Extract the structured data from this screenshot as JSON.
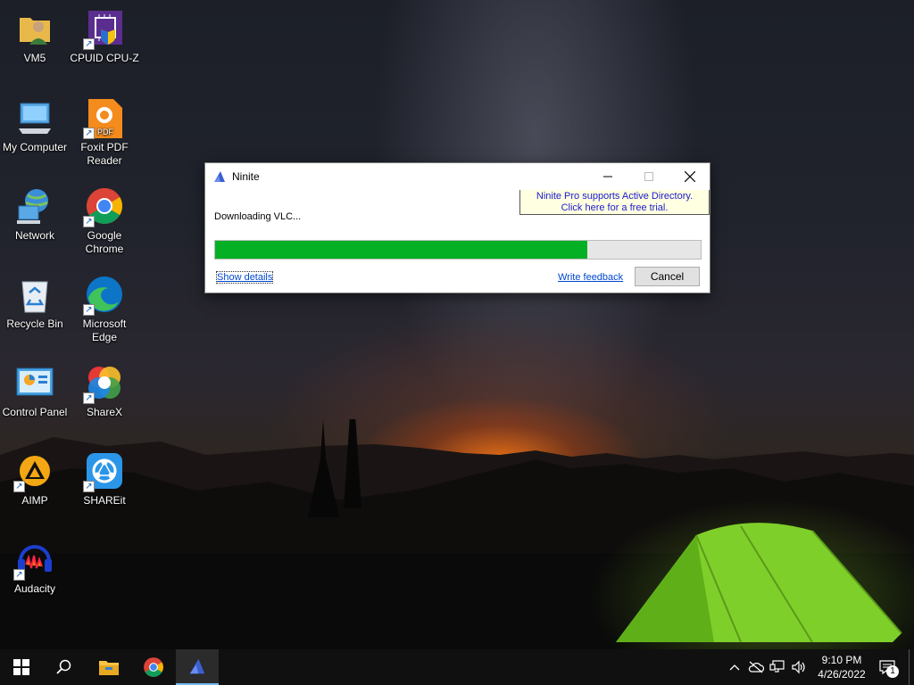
{
  "desktop": {
    "icons": [
      {
        "label": "VM5",
        "icon": "user-folder-icon"
      },
      {
        "label": "CPUID CPU-Z",
        "icon": "cpu-z-icon"
      },
      {
        "label": "My Computer",
        "icon": "computer-icon"
      },
      {
        "label": "Foxit PDF Reader",
        "icon": "foxit-pdf-icon"
      },
      {
        "label": "Network",
        "icon": "network-icon"
      },
      {
        "label": "Google Chrome",
        "icon": "chrome-icon"
      },
      {
        "label": "Recycle Bin",
        "icon": "recycle-bin-icon"
      },
      {
        "label": "Microsoft Edge",
        "icon": "edge-icon"
      },
      {
        "label": "Control Panel",
        "icon": "control-panel-icon"
      },
      {
        "label": "ShareX",
        "icon": "sharex-icon"
      },
      {
        "label": "AIMP",
        "icon": "aimp-icon"
      },
      {
        "label": "SHAREit",
        "icon": "shareit-icon"
      },
      {
        "label": "Audacity",
        "icon": "audacity-icon"
      }
    ]
  },
  "window": {
    "title": "Ninite",
    "promo_line1": "Ninite Pro supports Active Directory.",
    "promo_line2": "Click here for a free trial.",
    "status": "Downloading VLC...",
    "progress_fraction": 0.766,
    "show_details_label": "Show details",
    "feedback_label": "Write feedback",
    "cancel_label": "Cancel"
  },
  "taskbar": {
    "time": "9:10 PM",
    "date": "4/26/2022",
    "notification_count": "1"
  },
  "colors": {
    "progress_fill": "#06b025",
    "link": "#0047d0",
    "promo_bg": "#ffffe1"
  }
}
